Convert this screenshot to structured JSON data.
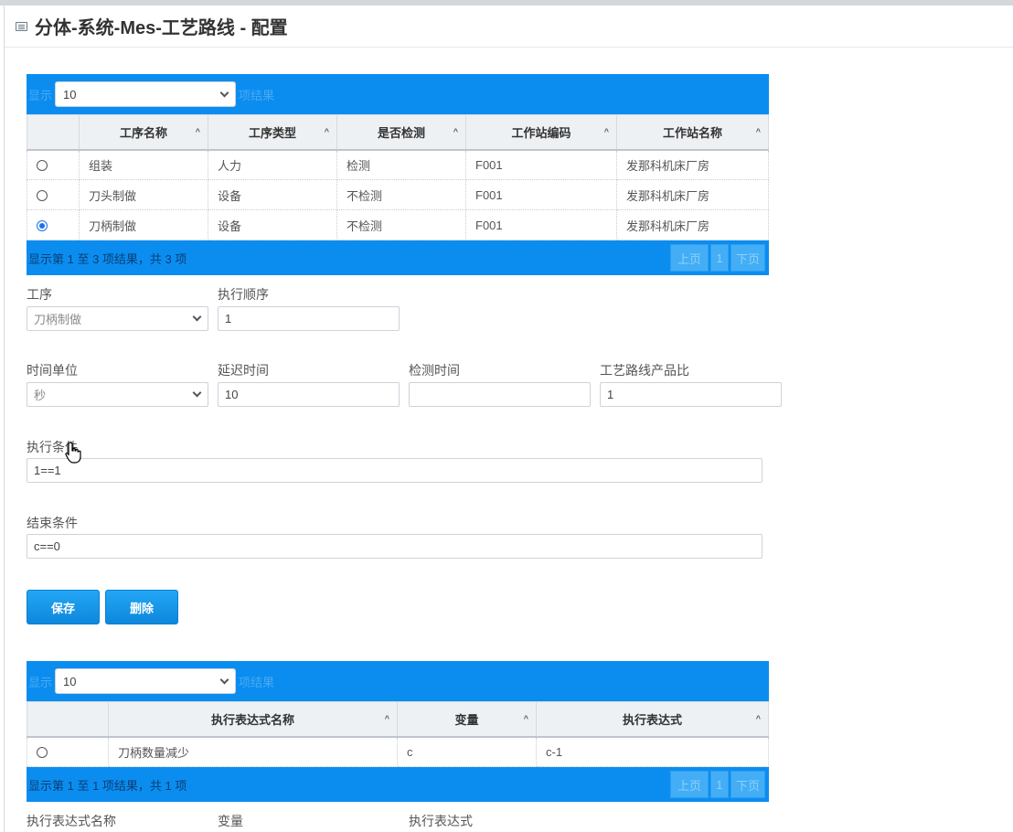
{
  "window": {
    "title": "分体-系统-Mes-工艺路线 - 配置"
  },
  "grid1": {
    "show_label": "显示",
    "length_value": "10",
    "results_label": "项结果",
    "columns": [
      "工序名称",
      "工序类型",
      "是否检测",
      "工作站编码",
      "工作站名称"
    ],
    "rows": [
      {
        "selected": false,
        "cells": [
          "组装",
          "人力",
          "检测",
          "F001",
          "发那科机床厂房"
        ]
      },
      {
        "selected": false,
        "cells": [
          "刀头制做",
          "设备",
          "不检测",
          "F001",
          "发那科机床厂房"
        ]
      },
      {
        "selected": true,
        "cells": [
          "刀柄制做",
          "设备",
          "不检测",
          "F001",
          "发那科机床厂房"
        ]
      }
    ],
    "info": "显示第 1 至 3 项结果，共 3 项",
    "prev": "上页",
    "page": "1",
    "next": "下页"
  },
  "form": {
    "process_label": "工序",
    "process_value": "刀柄制做",
    "order_label": "执行顺序",
    "order_value": "1",
    "time_unit_label": "时间单位",
    "time_unit_value": "秒",
    "delay_label": "延迟时间",
    "delay_value": "10",
    "check_time_label": "检测时间",
    "check_time_value": "",
    "ratio_label": "工艺路线产品比",
    "ratio_value": "1",
    "exec_cond_label": "执行条件",
    "exec_cond_value": "1==1",
    "end_cond_label": "结束条件",
    "end_cond_value": "c==0",
    "save": "保存",
    "delete": "删除"
  },
  "grid2": {
    "show_label": "显示",
    "length_value": "10",
    "results_label": "项结果",
    "columns": [
      "执行表达式名称",
      "变量",
      "执行表达式"
    ],
    "rows": [
      {
        "selected": false,
        "cells": [
          "刀柄数量减少",
          "c",
          "c-1"
        ]
      }
    ],
    "info": "显示第 1 至 1 项结果，共 1 项",
    "prev": "上页",
    "page": "1",
    "next": "下页"
  },
  "form2": {
    "name_label": "执行表达式名称",
    "var_label": "变量",
    "expr_label": "执行表达式"
  },
  "colors": {
    "grid_header": "#0b8df0",
    "button": "#1a9bea"
  }
}
